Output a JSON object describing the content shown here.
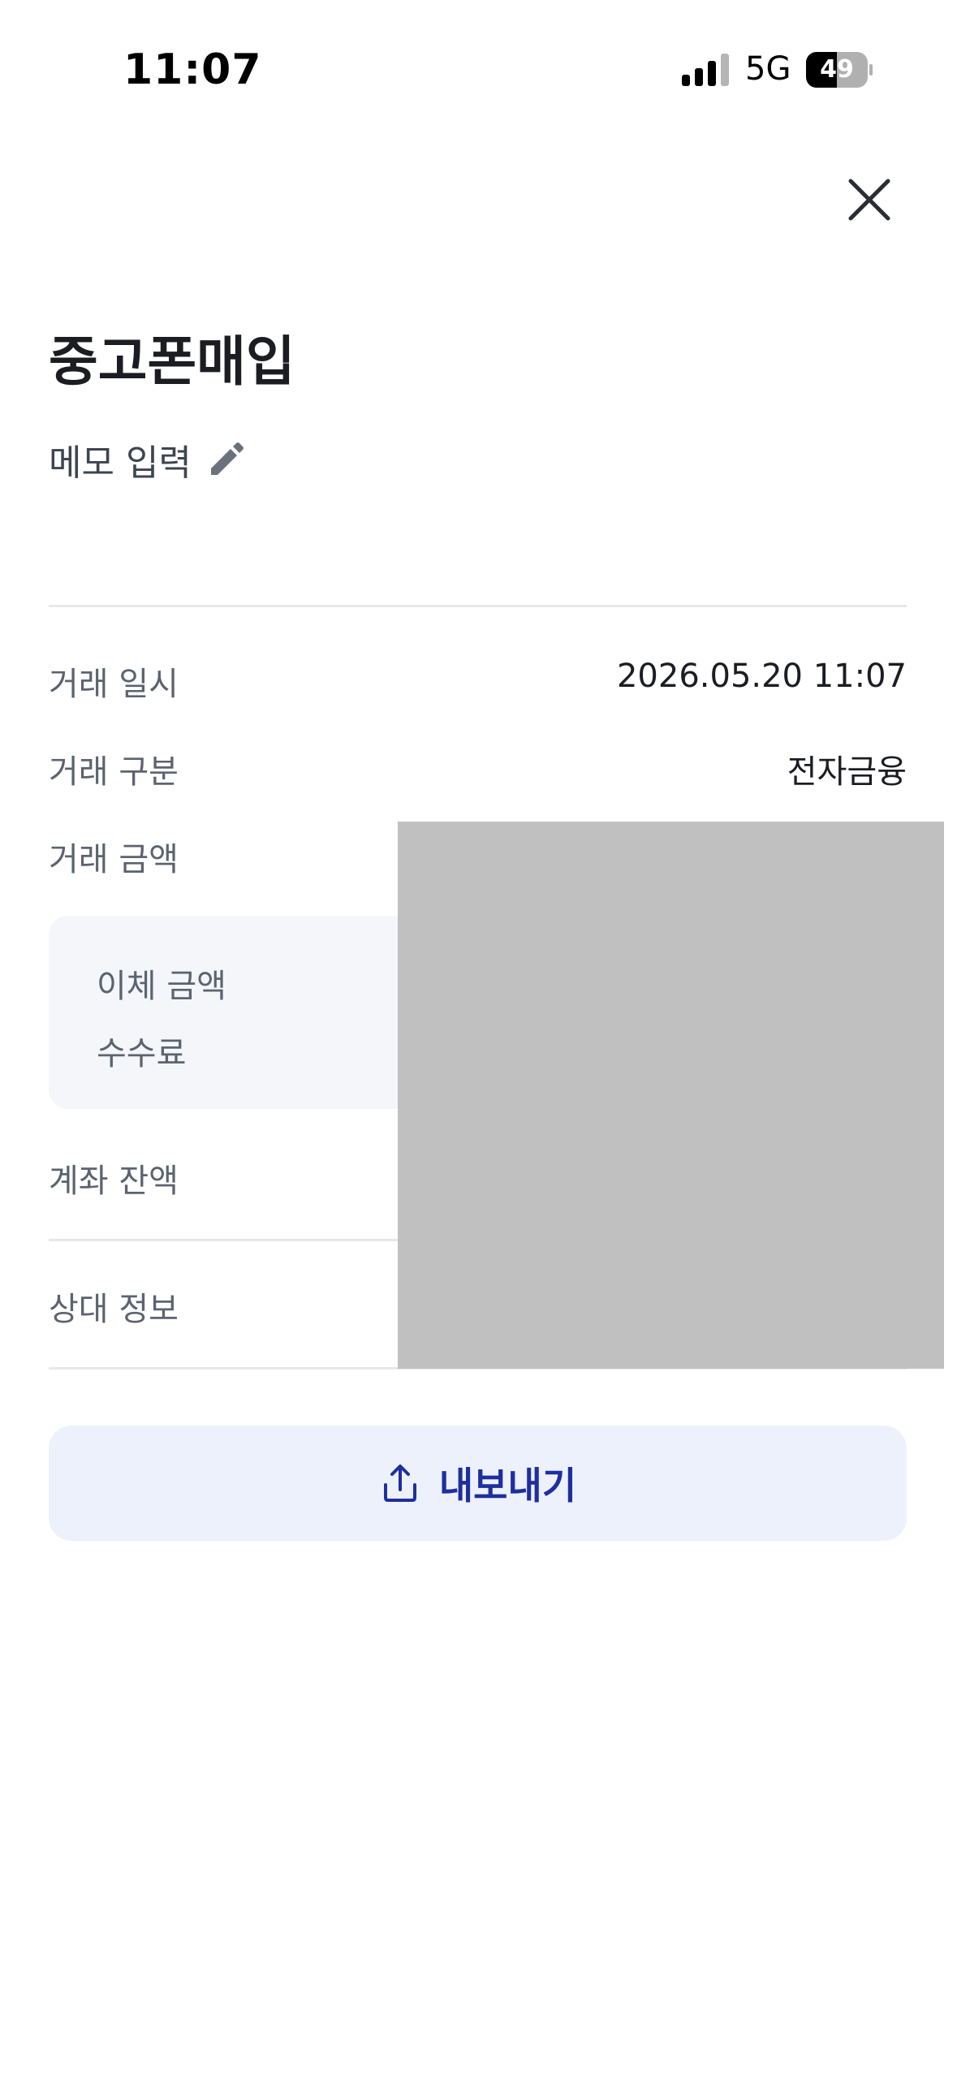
{
  "status_bar": {
    "time": "11:07",
    "network": "5G",
    "battery": "49"
  },
  "header": {
    "close_icon": "close-icon"
  },
  "transaction": {
    "title": "중고폰매입",
    "memo_label": "메모 입력",
    "memo_icon": "pencil-icon"
  },
  "details": {
    "datetime_label": "거래 일시",
    "datetime_value": "2026.05.20 11:07",
    "type_label": "거래 구분",
    "type_value": "전자금융",
    "amount_label": "거래 금액",
    "transfer_amount_label": "이체 금액",
    "fee_label": "수수료",
    "balance_label": "계좌 잔액",
    "counterparty_label": "상대 정보"
  },
  "actions": {
    "export_label": "내보내기",
    "export_icon": "share-upload-icon"
  },
  "colors": {
    "accent": "#1e2f9e",
    "button_bg": "#edf1fc",
    "sub_box_bg": "#f4f6fa",
    "redaction": "#c0c0c0"
  }
}
